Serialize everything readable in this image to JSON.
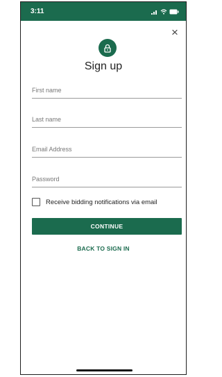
{
  "status_bar": {
    "time": "3:11",
    "background_color": "#1b6b4e",
    "icons": [
      "signal-icon",
      "wifi-icon",
      "battery-icon"
    ]
  },
  "header": {
    "title": "Sign up",
    "lock_icon": "lock-icon",
    "close_icon": "close-icon",
    "close_glyph": "×"
  },
  "form": {
    "fields": [
      {
        "label": "First name",
        "value": ""
      },
      {
        "label": "Last name",
        "value": ""
      },
      {
        "label": "Email Address",
        "value": ""
      },
      {
        "label": "Password",
        "value": ""
      }
    ],
    "notifications_checkbox": {
      "label": "Receive bidding notifications via email",
      "checked": false
    },
    "continue_label": "CONTINUE",
    "back_label": "BACK TO SIGN IN"
  },
  "colors": {
    "accent": "#1b6b4e"
  }
}
